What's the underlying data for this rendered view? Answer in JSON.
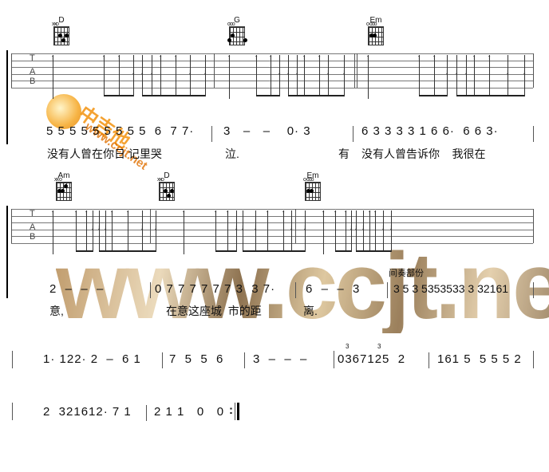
{
  "chords_row1": [
    {
      "name": "D",
      "open": "xxo"
    },
    {
      "name": "G",
      "open": "ooo"
    },
    {
      "name": "Em",
      "open": "o ooo"
    }
  ],
  "chords_row2": [
    {
      "name": "Am",
      "open": "xx o"
    },
    {
      "name": "D",
      "open": "xxo"
    },
    {
      "name": "Em",
      "open": "o ooo"
    }
  ],
  "tab_label": {
    "t": "T",
    "a": "A",
    "b": "B"
  },
  "strum_row1": [
    "up",
    "up",
    "up",
    "down",
    "down",
    "down",
    "up",
    "up",
    "down",
    "down",
    "up",
    "up",
    "up",
    "down",
    "down",
    "down",
    "up",
    "up",
    "down",
    "down",
    "up",
    "up",
    "up",
    "down",
    "down",
    "down",
    "up",
    "up",
    "down",
    "down"
  ],
  "strum_row2": [
    "up",
    "up",
    "up",
    "down",
    "down",
    "down",
    "up",
    "up",
    "down",
    "down",
    "up",
    "up",
    "up",
    "down",
    "down",
    "down",
    "up",
    "up",
    "down",
    "down",
    "up",
    "up",
    "up",
    "down",
    "down",
    "down",
    "up",
    "up",
    "down",
    "down"
  ],
  "line1": {
    "m1": "5 5 5 5 5 5 5 5 5  6  7 7·",
    "m2": "3   –   –    0· 3",
    "m3": "6 3 3 3 3 1 6 6·  6 6 3·"
  },
  "lyrics1": {
    "a": "没有人曾在你日 记里哭",
    "b": "泣.",
    "c": "有",
    "d": "没有人曾告诉你    我很在"
  },
  "line2": {
    "m1": "2  –  –  –",
    "m2": "0 7 7 7 7 7 7 3  3 7·",
    "m3": "6  –  –  3",
    "m4": "3 5 3 5353533 3 32161"
  },
  "interlude_label": "间奏部份",
  "lyrics2": {
    "a": "意,",
    "b": "在意这座城  市的距",
    "c": "离."
  },
  "line3": {
    "m1": "1· 122· 2  –  6 1",
    "m2": "7  5  5  6",
    "m3": "3  –  –  –",
    "m4": "0367125  2",
    "m5": "161 5  5 5 5 2"
  },
  "line4": {
    "m1": "2  321612· 7 1",
    "m2": "2 1 1   0   0"
  },
  "triplet": "3",
  "watermark": "www.ccjt.net",
  "logo": {
    "text": "中吉他",
    "url": "www.ccjt.net"
  }
}
